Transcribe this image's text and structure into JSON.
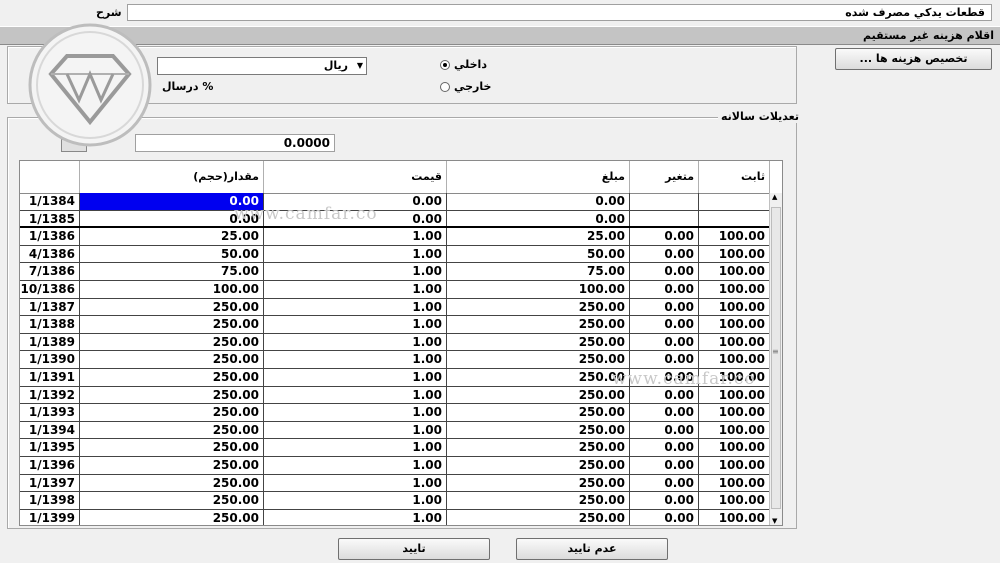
{
  "header": {
    "description_label": "شرح",
    "description_value": "قطعات يدكي مصرف شده",
    "subheading": "اقلام هزينه غير مستقيم"
  },
  "options": {
    "currency_value": "ريال",
    "percent_label": "درسال %",
    "radio_domestic": "داخلي",
    "radio_foreign": "خارجي",
    "selected": "domestic"
  },
  "allocate_button": "... تخصيص هزينه ها",
  "annual_adjustments": {
    "title": "تعديلات سالانه",
    "value": "0.0000"
  },
  "grid": {
    "columns": {
      "fixed": "ثابت",
      "variable": "متغير",
      "amount": "مبلغ",
      "price": "قيمت",
      "quantity": "مقدار(حجم)",
      "date": ""
    },
    "rows": [
      {
        "fixed": "",
        "variable": "",
        "amount": "0.00",
        "price": "0.00",
        "quantity": "0.00",
        "date": "1/1384"
      },
      {
        "fixed": "",
        "variable": "",
        "amount": "0.00",
        "price": "0.00",
        "quantity": "0.00",
        "date": "1/1385"
      },
      {
        "fixed": "100.00",
        "variable": "0.00",
        "amount": "25.00",
        "price": "1.00",
        "quantity": "25.00",
        "date": "1/1386"
      },
      {
        "fixed": "100.00",
        "variable": "0.00",
        "amount": "50.00",
        "price": "1.00",
        "quantity": "50.00",
        "date": "4/1386"
      },
      {
        "fixed": "100.00",
        "variable": "0.00",
        "amount": "75.00",
        "price": "1.00",
        "quantity": "75.00",
        "date": "7/1386"
      },
      {
        "fixed": "100.00",
        "variable": "0.00",
        "amount": "100.00",
        "price": "1.00",
        "quantity": "100.00",
        "date": "10/1386"
      },
      {
        "fixed": "100.00",
        "variable": "0.00",
        "amount": "250.00",
        "price": "1.00",
        "quantity": "250.00",
        "date": "1/1387"
      },
      {
        "fixed": "100.00",
        "variable": "0.00",
        "amount": "250.00",
        "price": "1.00",
        "quantity": "250.00",
        "date": "1/1388"
      },
      {
        "fixed": "100.00",
        "variable": "0.00",
        "amount": "250.00",
        "price": "1.00",
        "quantity": "250.00",
        "date": "1/1389"
      },
      {
        "fixed": "100.00",
        "variable": "0.00",
        "amount": "250.00",
        "price": "1.00",
        "quantity": "250.00",
        "date": "1/1390"
      },
      {
        "fixed": "100.00",
        "variable": "0.00",
        "amount": "250.00",
        "price": "1.00",
        "quantity": "250.00",
        "date": "1/1391"
      },
      {
        "fixed": "100.00",
        "variable": "0.00",
        "amount": "250.00",
        "price": "1.00",
        "quantity": "250.00",
        "date": "1/1392"
      },
      {
        "fixed": "100.00",
        "variable": "0.00",
        "amount": "250.00",
        "price": "1.00",
        "quantity": "250.00",
        "date": "1/1393"
      },
      {
        "fixed": "100.00",
        "variable": "0.00",
        "amount": "250.00",
        "price": "1.00",
        "quantity": "250.00",
        "date": "1/1394"
      },
      {
        "fixed": "100.00",
        "variable": "0.00",
        "amount": "250.00",
        "price": "1.00",
        "quantity": "250.00",
        "date": "1/1395"
      },
      {
        "fixed": "100.00",
        "variable": "0.00",
        "amount": "250.00",
        "price": "1.00",
        "quantity": "250.00",
        "date": "1/1396"
      },
      {
        "fixed": "100.00",
        "variable": "0.00",
        "amount": "250.00",
        "price": "1.00",
        "quantity": "250.00",
        "date": "1/1397"
      },
      {
        "fixed": "100.00",
        "variable": "0.00",
        "amount": "250.00",
        "price": "1.00",
        "quantity": "250.00",
        "date": "1/1398"
      },
      {
        "fixed": "100.00",
        "variable": "0.00",
        "amount": "250.00",
        "price": "1.00",
        "quantity": "250.00",
        "date": "1/1399"
      }
    ]
  },
  "footer": {
    "confirm": "تاييد",
    "reject": "عدم تاييد"
  },
  "watermark": {
    "text1": "www.camfar.co",
    "text2": "www.camfar.co"
  }
}
